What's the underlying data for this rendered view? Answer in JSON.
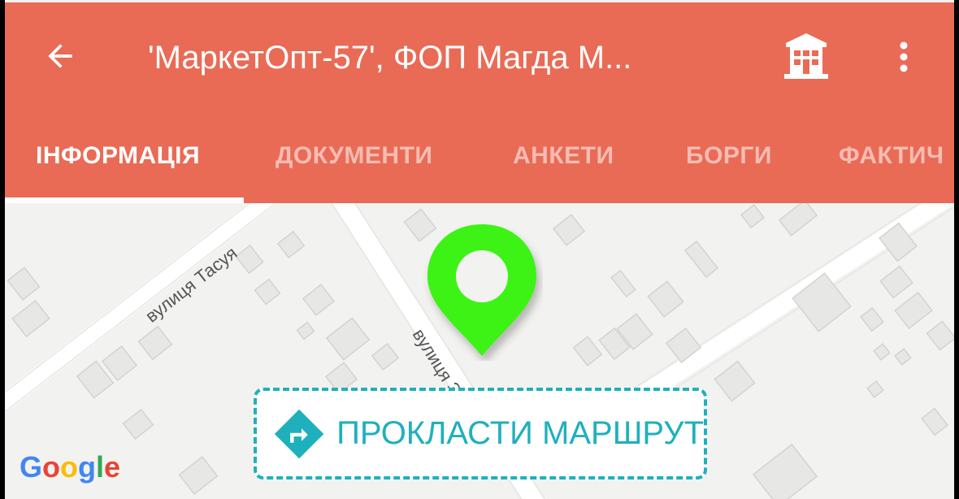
{
  "header": {
    "back_icon": "arrow-left-icon",
    "title": "'МаркетОпт-57', ФОП Магда М...",
    "building_icon": "building-icon",
    "more_icon": "more-vertical-icon",
    "background_color": "#e96b56"
  },
  "tabs": [
    {
      "label": "ІНФОРМАЦІЯ",
      "active": true
    },
    {
      "label": "ДОКУМЕНТИ",
      "active": false
    },
    {
      "label": "АНКЕТИ",
      "active": false
    },
    {
      "label": "БОРГИ",
      "active": false
    },
    {
      "label": "ФАКТИЧ",
      "active": false
    }
  ],
  "map": {
    "streets": [
      {
        "label": "вулиця Тасуя"
      },
      {
        "label": "вулиця З"
      }
    ],
    "pin_icon": "map-pin-icon",
    "pin_color": "#3cf312",
    "route_button": {
      "icon": "directions-icon",
      "label": "ПРОКЛАСТИ МАРШРУТ",
      "color": "#1fb0bd"
    },
    "google_logo": "Google"
  }
}
